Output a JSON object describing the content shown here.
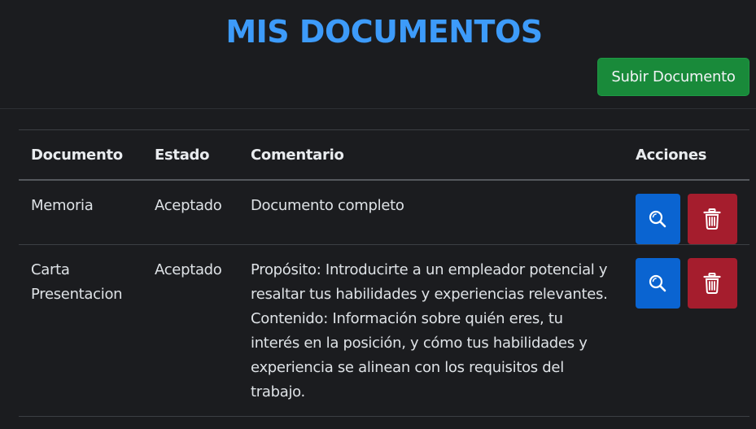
{
  "header": {
    "title": "MIS DOCUMENTOS",
    "upload_label": "Subir Documento"
  },
  "table": {
    "columns": [
      "Documento",
      "Estado",
      "Comentario",
      "Acciones"
    ],
    "rows": [
      {
        "documento": "Memoria",
        "estado": "Aceptado",
        "comentario": "Documento completo",
        "view_icon": "search-icon",
        "delete_icon": "trash-icon"
      },
      {
        "documento": "Carta Presentacion",
        "estado": "Aceptado",
        "comentario": "Propósito: Introducirte a un empleador potencial y resaltar tus habilidades y experiencias relevantes. Contenido: Información sobre quién eres, tu interés en la posición, y cómo tus habilidades y experiencia se alinean con los requisitos del trabajo.",
        "view_icon": "search-icon",
        "delete_icon": "trash-icon"
      }
    ]
  },
  "colors": {
    "background": "#1b1c1f",
    "title": "#3d9bfa",
    "upload_button": "#198a3a",
    "view_button": "#0a64d1",
    "delete_button": "#a51d2d"
  }
}
